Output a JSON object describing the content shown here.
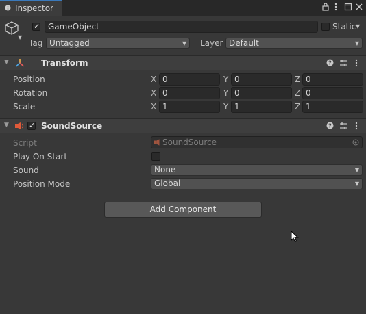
{
  "window": {
    "tab_label": "Inspector"
  },
  "header": {
    "object_name": "GameObject",
    "static_label": "Static",
    "tag_label": "Tag",
    "tag_value": "Untagged",
    "layer_label": "Layer",
    "layer_value": "Default"
  },
  "transform": {
    "title": "Transform",
    "rows": [
      {
        "label": "Position",
        "x": "0",
        "y": "0",
        "z": "0"
      },
      {
        "label": "Rotation",
        "x": "0",
        "y": "0",
        "z": "0"
      },
      {
        "label": "Scale",
        "x": "1",
        "y": "1",
        "z": "1"
      }
    ],
    "axis": {
      "x": "X",
      "y": "Y",
      "z": "Z"
    }
  },
  "sound_source": {
    "title": "SoundSource",
    "script_label": "Script",
    "script_value": "SoundSource",
    "play_on_start_label": "Play On Start",
    "sound_label": "Sound",
    "sound_value": "None",
    "position_mode_label": "Position Mode",
    "position_mode_value": "Global"
  },
  "footer": {
    "add_component_label": "Add Component"
  },
  "colors": {
    "tab_accent": "#3a79bb",
    "transform_icon": "#e0a24a",
    "audio_icon": "#e05a3a"
  }
}
